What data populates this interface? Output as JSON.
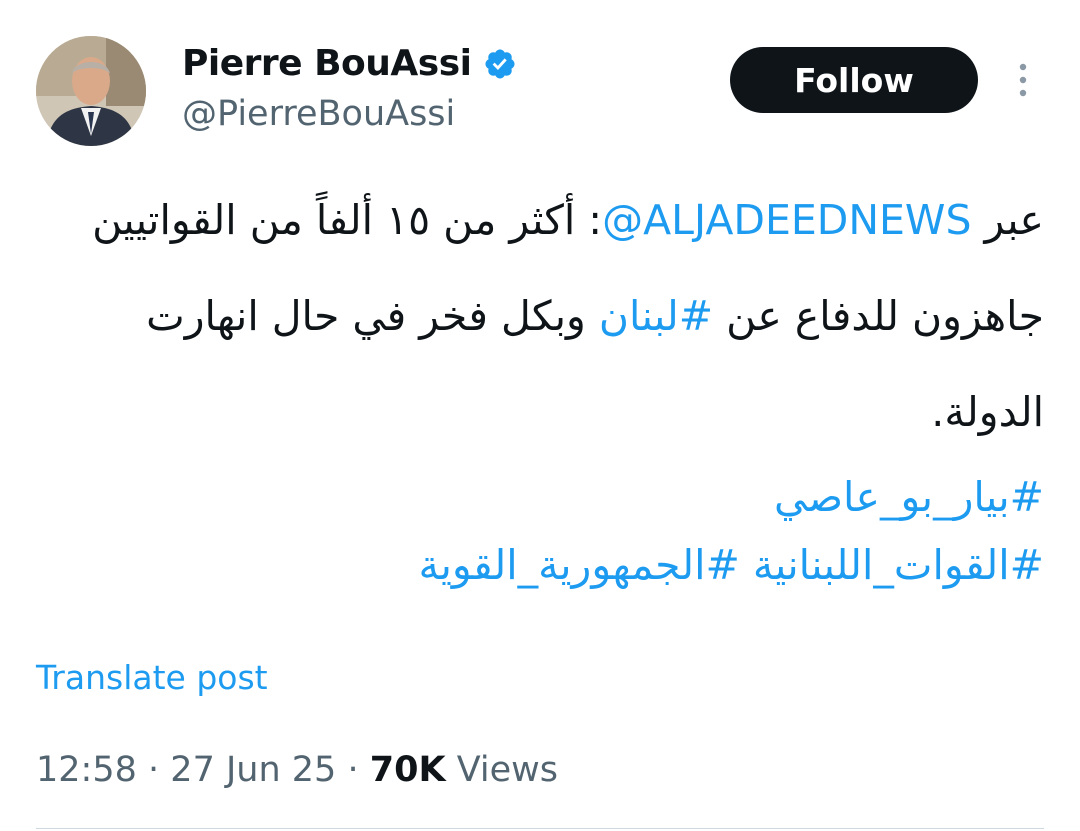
{
  "author": {
    "display_name": "Pierre BouAssi",
    "handle": "@PierreBouAssi",
    "verified": true
  },
  "actions": {
    "follow_label": "Follow",
    "more_icon": "more-vertical-icon"
  },
  "tweet": {
    "line1_prefix": "عبر ",
    "mention": "@ALJADEEDNEWS",
    "line1_suffix": ": أكثر من ١٥ ألفاً من القواتيين جاهزون للدفاع عن ",
    "hashtag_lebanon": "#لبنان",
    "line1_end": " وبكل فخر في حال انهارت الدولة.",
    "hashtag_1": "#بيار_بو_عاصي",
    "hashtag_2": "#القوات_اللبنانية",
    "hashtag_3": "#الجمهورية_القوية"
  },
  "translate_label": "Translate post",
  "meta": {
    "time": "12:58",
    "separator": "·",
    "date": "27 Jun 25",
    "views_count": "70K",
    "views_label": "Views"
  },
  "colors": {
    "link": "#1d9bf0",
    "text": "#0f1419",
    "secondary": "#536471",
    "button_bg": "#0f1419"
  }
}
